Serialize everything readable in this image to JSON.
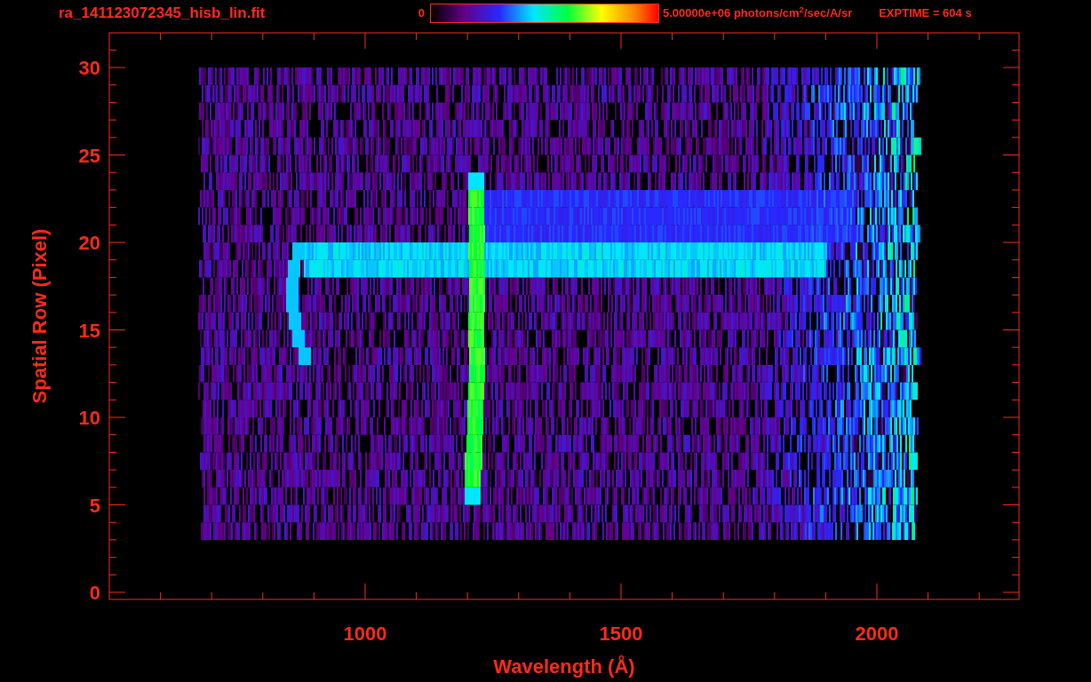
{
  "title": "ra_141123072345_hisb_lin.fit",
  "colorbar": {
    "min_label": "0",
    "max_label": "5.00000e+06 photons/cm$^{2}$/sec/A/sr"
  },
  "exptime": "EXPTIME = 604 s",
  "plot": {
    "ylabel": "Spatial Row (Pixel)",
    "xlabel": "Wavelength (Å)",
    "yticks": [
      "30",
      "25",
      "20",
      "15",
      "10",
      "5",
      "0"
    ],
    "xticks": [
      "1000",
      "1500",
      "2000"
    ]
  }
}
